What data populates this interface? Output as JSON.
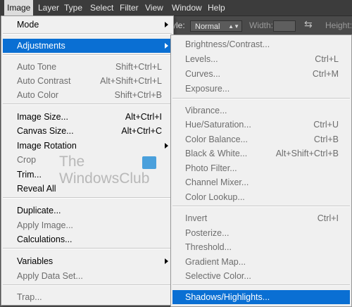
{
  "menubar": {
    "items": [
      "Image",
      "Layer",
      "Type",
      "Select",
      "Filter",
      "View",
      "Window",
      "Help"
    ]
  },
  "options_bar": {
    "style_label": "yle:",
    "style_value": "Normal",
    "width_label": "Width:",
    "height_label": "Height:"
  },
  "image_menu": {
    "items": [
      {
        "label": "Mode",
        "shortcut": "",
        "disabled": false,
        "submenu": true
      },
      {
        "label": "Adjustments",
        "shortcut": "",
        "disabled": false,
        "submenu": true,
        "highlighted": true
      },
      {
        "label": "Auto Tone",
        "shortcut": "Shift+Ctrl+L",
        "disabled": true
      },
      {
        "label": "Auto Contrast",
        "shortcut": "Alt+Shift+Ctrl+L",
        "disabled": true
      },
      {
        "label": "Auto Color",
        "shortcut": "Shift+Ctrl+B",
        "disabled": true
      },
      {
        "label": "Image Size...",
        "shortcut": "Alt+Ctrl+I",
        "disabled": false
      },
      {
        "label": "Canvas Size...",
        "shortcut": "Alt+Ctrl+C",
        "disabled": false
      },
      {
        "label": "Image Rotation",
        "shortcut": "",
        "disabled": false,
        "submenu": true
      },
      {
        "label": "Crop",
        "shortcut": "",
        "disabled": true
      },
      {
        "label": "Trim...",
        "shortcut": "",
        "disabled": false
      },
      {
        "label": "Reveal All",
        "shortcut": "",
        "disabled": false
      },
      {
        "label": "Duplicate...",
        "shortcut": "",
        "disabled": false
      },
      {
        "label": "Apply Image...",
        "shortcut": "",
        "disabled": true
      },
      {
        "label": "Calculations...",
        "shortcut": "",
        "disabled": false
      },
      {
        "label": "Variables",
        "shortcut": "",
        "disabled": false,
        "submenu": true
      },
      {
        "label": "Apply Data Set...",
        "shortcut": "",
        "disabled": true
      },
      {
        "label": "Trap...",
        "shortcut": "",
        "disabled": true
      }
    ]
  },
  "adjustments_menu": {
    "items": [
      {
        "label": "Brightness/Contrast...",
        "shortcut": "",
        "disabled": true
      },
      {
        "label": "Levels...",
        "shortcut": "Ctrl+L",
        "disabled": true
      },
      {
        "label": "Curves...",
        "shortcut": "Ctrl+M",
        "disabled": true
      },
      {
        "label": "Exposure...",
        "shortcut": "",
        "disabled": true
      },
      {
        "label": "Vibrance...",
        "shortcut": "",
        "disabled": true
      },
      {
        "label": "Hue/Saturation...",
        "shortcut": "Ctrl+U",
        "disabled": true
      },
      {
        "label": "Color Balance...",
        "shortcut": "Ctrl+B",
        "disabled": true
      },
      {
        "label": "Black & White...",
        "shortcut": "Alt+Shift+Ctrl+B",
        "disabled": true
      },
      {
        "label": "Photo Filter...",
        "shortcut": "",
        "disabled": true
      },
      {
        "label": "Channel Mixer...",
        "shortcut": "",
        "disabled": true
      },
      {
        "label": "Color Lookup...",
        "shortcut": "",
        "disabled": true
      },
      {
        "label": "Invert",
        "shortcut": "Ctrl+I",
        "disabled": true
      },
      {
        "label": "Posterize...",
        "shortcut": "",
        "disabled": true
      },
      {
        "label": "Threshold...",
        "shortcut": "",
        "disabled": true
      },
      {
        "label": "Gradient Map...",
        "shortcut": "",
        "disabled": true
      },
      {
        "label": "Selective Color...",
        "shortcut": "",
        "disabled": true
      },
      {
        "label": "Shadows/Highlights...",
        "shortcut": "",
        "disabled": false,
        "highlighted": true
      }
    ]
  },
  "watermark": {
    "line1": "The",
    "line2": "WindowsClub"
  },
  "colors": {
    "highlight": "#0a6fd3",
    "menu_bg": "#f0f0f0",
    "disabled_text": "#6d6d6d"
  }
}
